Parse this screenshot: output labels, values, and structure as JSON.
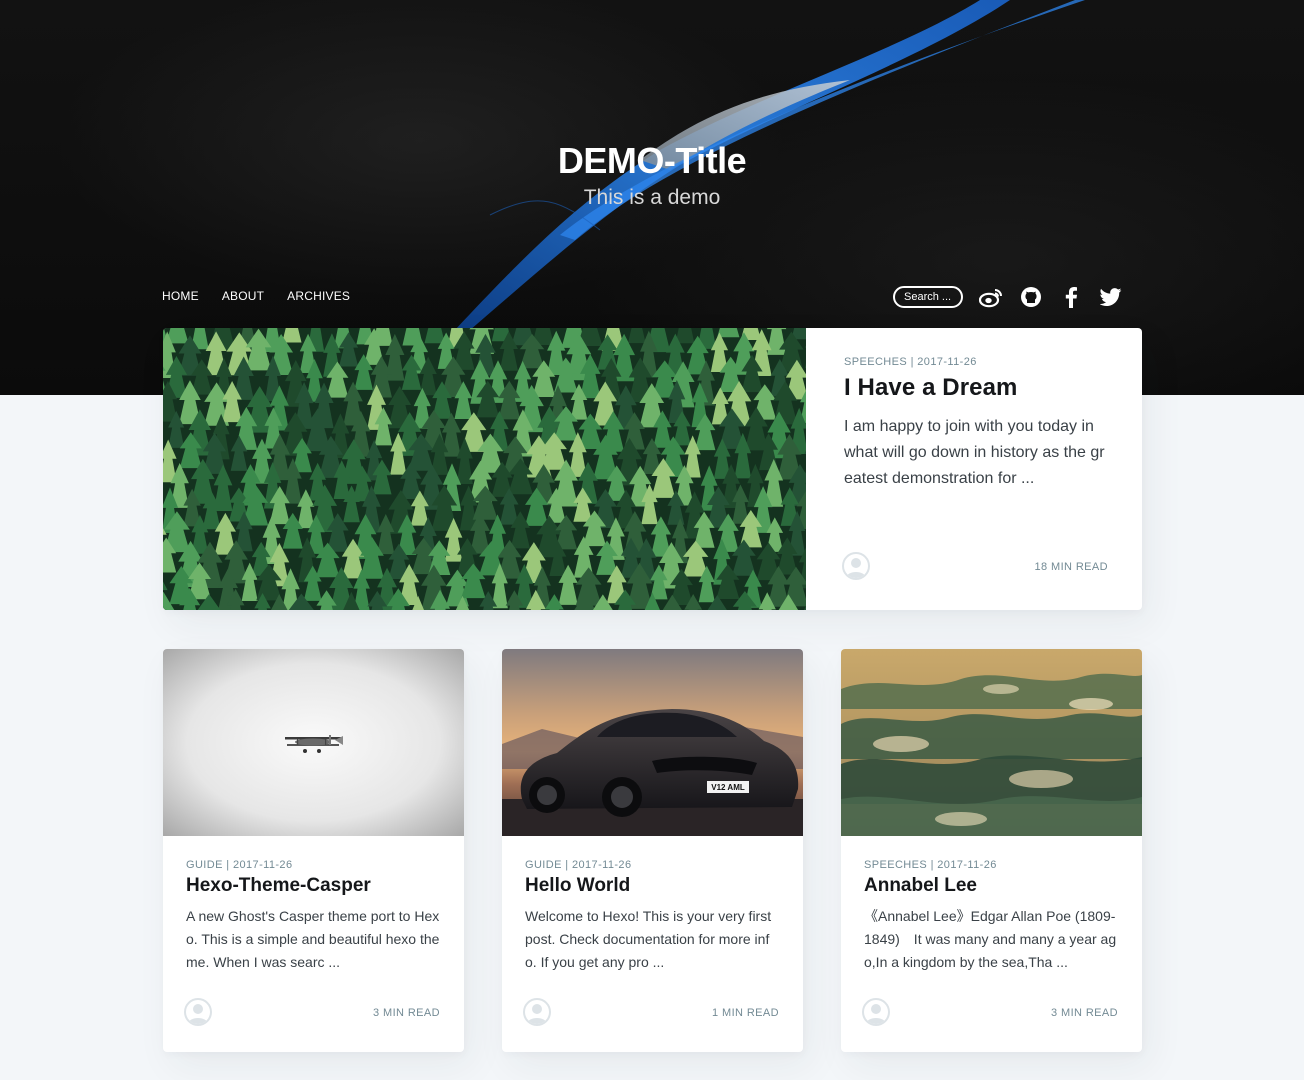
{
  "site": {
    "title": "DEMO-Title",
    "subtitle": "This is a demo"
  },
  "nav": {
    "links": [
      {
        "label": "HOME"
      },
      {
        "label": "ABOUT"
      },
      {
        "label": "ARCHIVES"
      }
    ],
    "search_placeholder": "Search ...",
    "social": [
      "weibo-icon",
      "github-icon",
      "facebook-icon",
      "twitter-icon"
    ]
  },
  "featured": {
    "category": "SPEECHES",
    "date": "2017-11-26",
    "meta": "SPEECHES | 2017-11-26",
    "title": "I Have a Dream",
    "excerpt": "I am happy to join with you today in what will go down in history as the greatest demonstration for ...",
    "read_time": "18 MIN READ",
    "image": "pine-forest-illustration"
  },
  "posts": [
    {
      "meta": "GUIDE | 2017-11-26",
      "title": "Hexo-Theme-Casper",
      "excerpt": "A new Ghost's Casper theme port to Hexo. This is a simple and beautiful hexo theme. When I was searc ...",
      "read_time": "3 MIN READ",
      "image": "biplane-on-white"
    },
    {
      "meta": "GUIDE | 2017-11-26",
      "title": "Hello World",
      "excerpt": "Welcome to Hexo! This is your very first post. Check documentation for more info. If you get any pro ...",
      "read_time": "1 MIN READ",
      "image": "sports-car-sunset",
      "plate": "V12 AML"
    },
    {
      "meta": "SPEECHES | 2017-11-26",
      "title": "Annabel Lee",
      "excerpt": "《Annabel Lee》Edgar Allan Poe (1809-1849)　It was many and many a year ago,In a kingdom by the sea,Tha ...",
      "read_time": "3 MIN READ",
      "image": "landscape-painting"
    }
  ],
  "colors": {
    "hero_bg": "#0b0b0b",
    "page_bg": "#f3f6f9",
    "meta_text": "#738a94",
    "title_text": "#15171a",
    "ribbon_blue": "#1f6fd1"
  }
}
